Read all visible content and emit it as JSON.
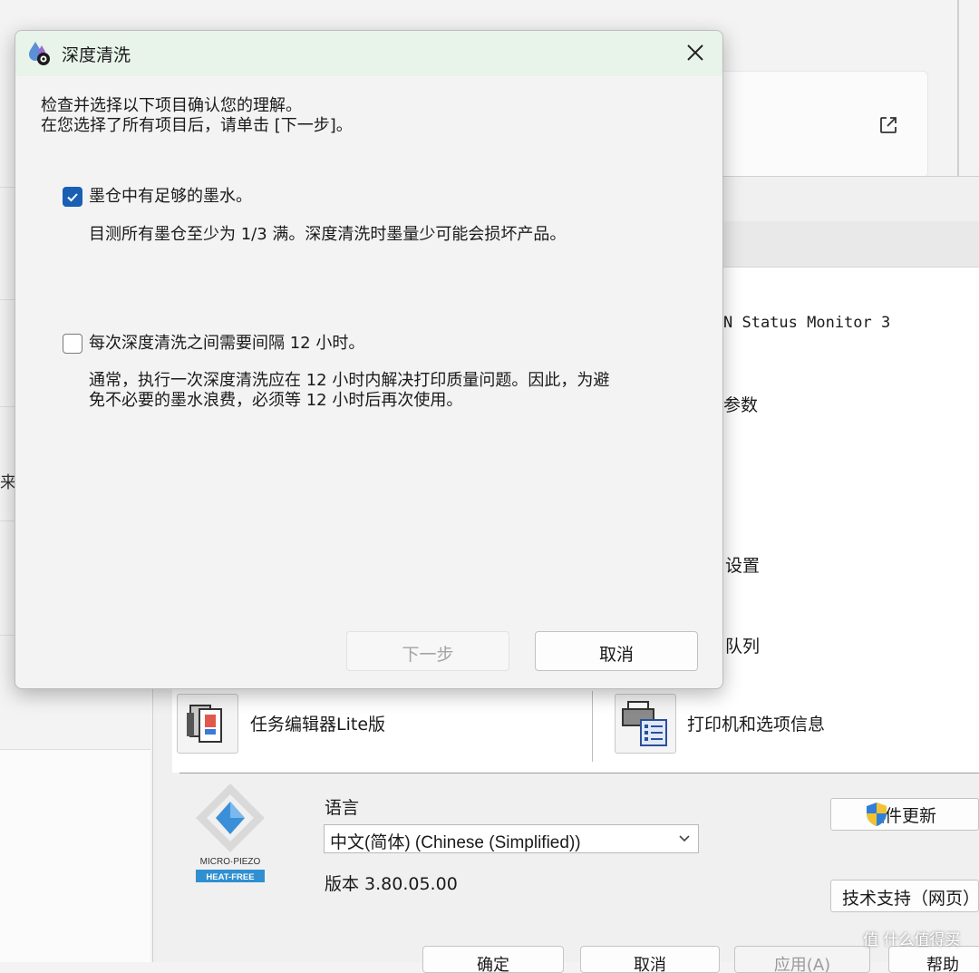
{
  "dialog": {
    "title": "深度清洗",
    "intro_line1": "检查并选择以下项目确认您的理解。",
    "intro_line2": "在您选择了所有项目后，请单击 [下一步]。",
    "items": [
      {
        "label": "墨仓中有足够的墨水。",
        "checked": true,
        "description": [
          "目测所有墨仓至少为 1/3 满。深度清洗时墨量少可能会损坏产品。"
        ]
      },
      {
        "label": "每次深度清洗之间需要间隔 12 小时。",
        "checked": false,
        "description": [
          "通常，执行一次深度清洗应在 12 小时内解决打印质量问题。因此，为避",
          "免不必要的墨水浪费，必须等 12 小时后再次使用。"
        ]
      }
    ],
    "next_label": "下一步",
    "cancel_label": "取消"
  },
  "utility": {
    "status_monitor_partial": "N Status Monitor 3",
    "params_partial": "参数",
    "settings_partial": "设置",
    "queue_partial": "队列",
    "job_editor_label": "任务编辑器Lite版",
    "printer_info_label": "打印机和选项信息",
    "language_label": "语言",
    "language_value": "中文(简体) (Chinese (Simplified))",
    "version_text": "版本 3.80.05.00",
    "update_label": "软件更新",
    "support_label": "技术支持（网页）",
    "footer_buttons": [
      "确定",
      "取消",
      "应用(A)",
      "帮助"
    ],
    "logo_top": "MICRO·PIEZO",
    "logo_bottom": "HEAT-FREE"
  },
  "background": {
    "left_char": "来"
  },
  "watermark": "值 什么值得买",
  "colors": {
    "accent": "#1a5fb4",
    "titlebar": "#e8f3ea",
    "logo_blue": "#3a8fd8",
    "logo_badge": "#2f8fd0"
  }
}
